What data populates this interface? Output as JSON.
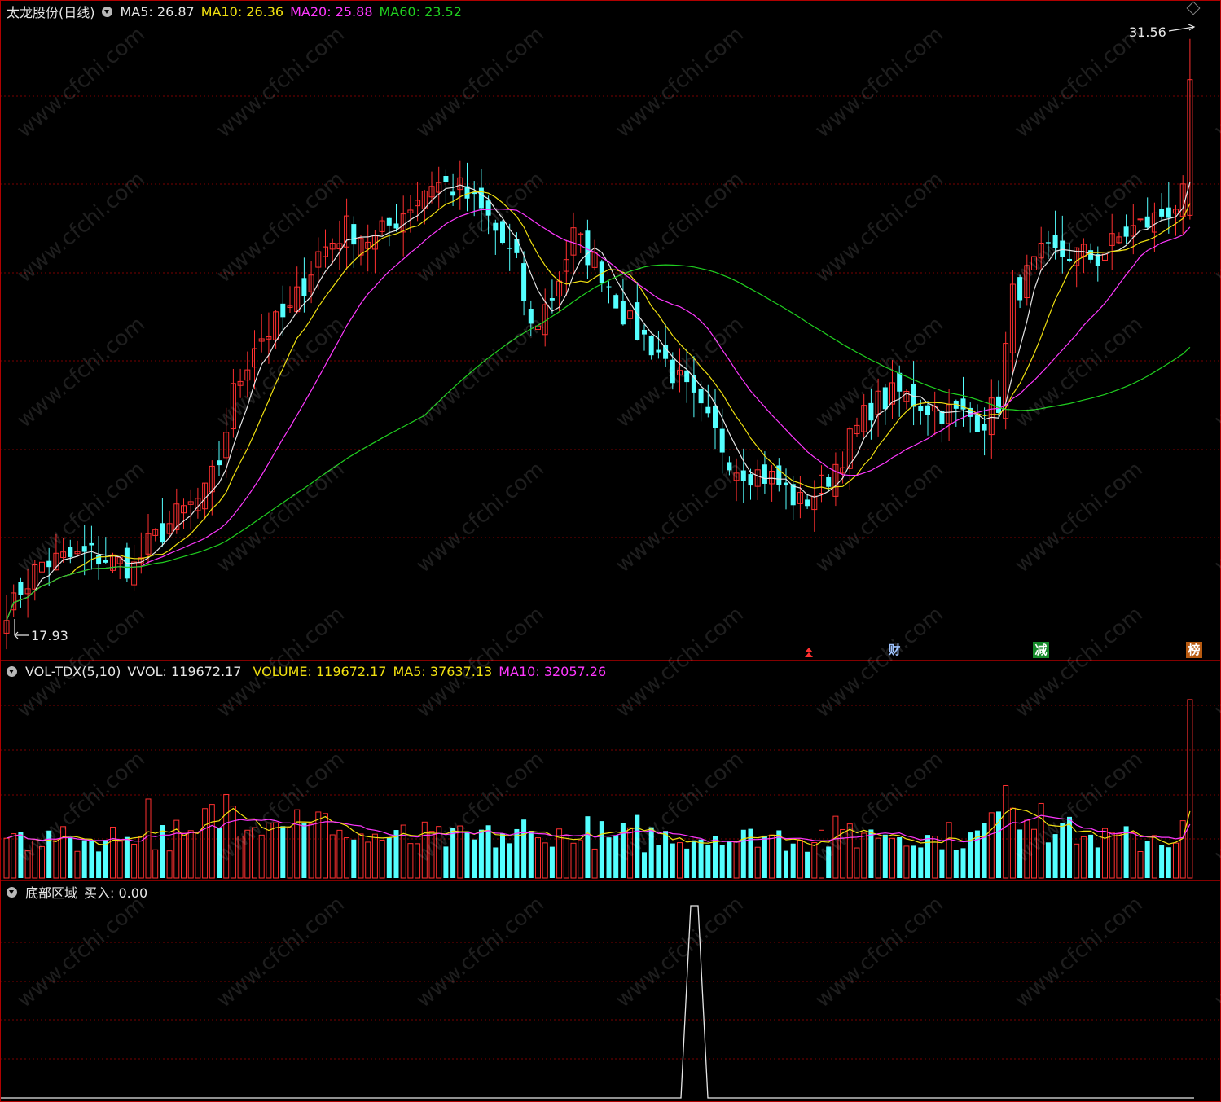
{
  "colors": {
    "up": "#ff3030",
    "down": "#54ffff",
    "ma5": "#e6e6e6",
    "ma10": "#f0e010",
    "ma20": "#ff38ff",
    "ma60": "#20d020",
    "grid": "#7a0000",
    "vol_ma5": "#f0e010",
    "vol_ma10": "#ff38ff"
  },
  "main": {
    "title": "太龙股份(日线)",
    "ma5_label": "MA5: 26.87",
    "ma10_label": "MA10: 26.36",
    "ma20_label": "MA20: 25.88",
    "ma60_label": "MA60: 23.52",
    "high_label": "31.56",
    "low_label": "17.93",
    "markers": [
      {
        "text": "财",
        "icon": "finance-report-icon",
        "bg": "#1c3c9c",
        "color": "#ffffff"
      },
      {
        "text": "减",
        "icon": "reduction-icon",
        "bg": "#158a2a",
        "color": "#ffffff"
      },
      {
        "text": "榜",
        "icon": "rank-list-icon",
        "bg": "#b85a10",
        "color": "#ffffff"
      }
    ]
  },
  "volume": {
    "name": "VOL-TDX(5,10)",
    "vvol": "VVOL: 119672.17",
    "volume": "VOLUME: 119672.17",
    "ma5": "MA5: 37637.13",
    "ma10": "MA10: 32057.26"
  },
  "bottom": {
    "name": "底部区域",
    "buy": "买入: 0.00"
  },
  "chart_data": [
    {
      "type": "candlestick",
      "title": "太龙股份(日线)",
      "series": [
        {
          "name": "MA5",
          "last": 26.87
        },
        {
          "name": "MA10",
          "last": 26.36
        },
        {
          "name": "MA20",
          "last": 25.88
        },
        {
          "name": "MA60",
          "last": 23.52
        }
      ],
      "annotations": {
        "high": 31.56,
        "low": 17.93
      }
    },
    {
      "type": "bar",
      "title": "VOL-TDX(5,10)",
      "series": [
        {
          "name": "VVOL",
          "last": 119672.17
        },
        {
          "name": "VOLUME",
          "last": 119672.17
        },
        {
          "name": "MA5",
          "last": 37637.13
        },
        {
          "name": "MA10",
          "last": 32057.26
        }
      ]
    },
    {
      "type": "line",
      "title": "底部区域",
      "series": [
        {
          "name": "买入",
          "last": 0.0
        }
      ]
    }
  ]
}
